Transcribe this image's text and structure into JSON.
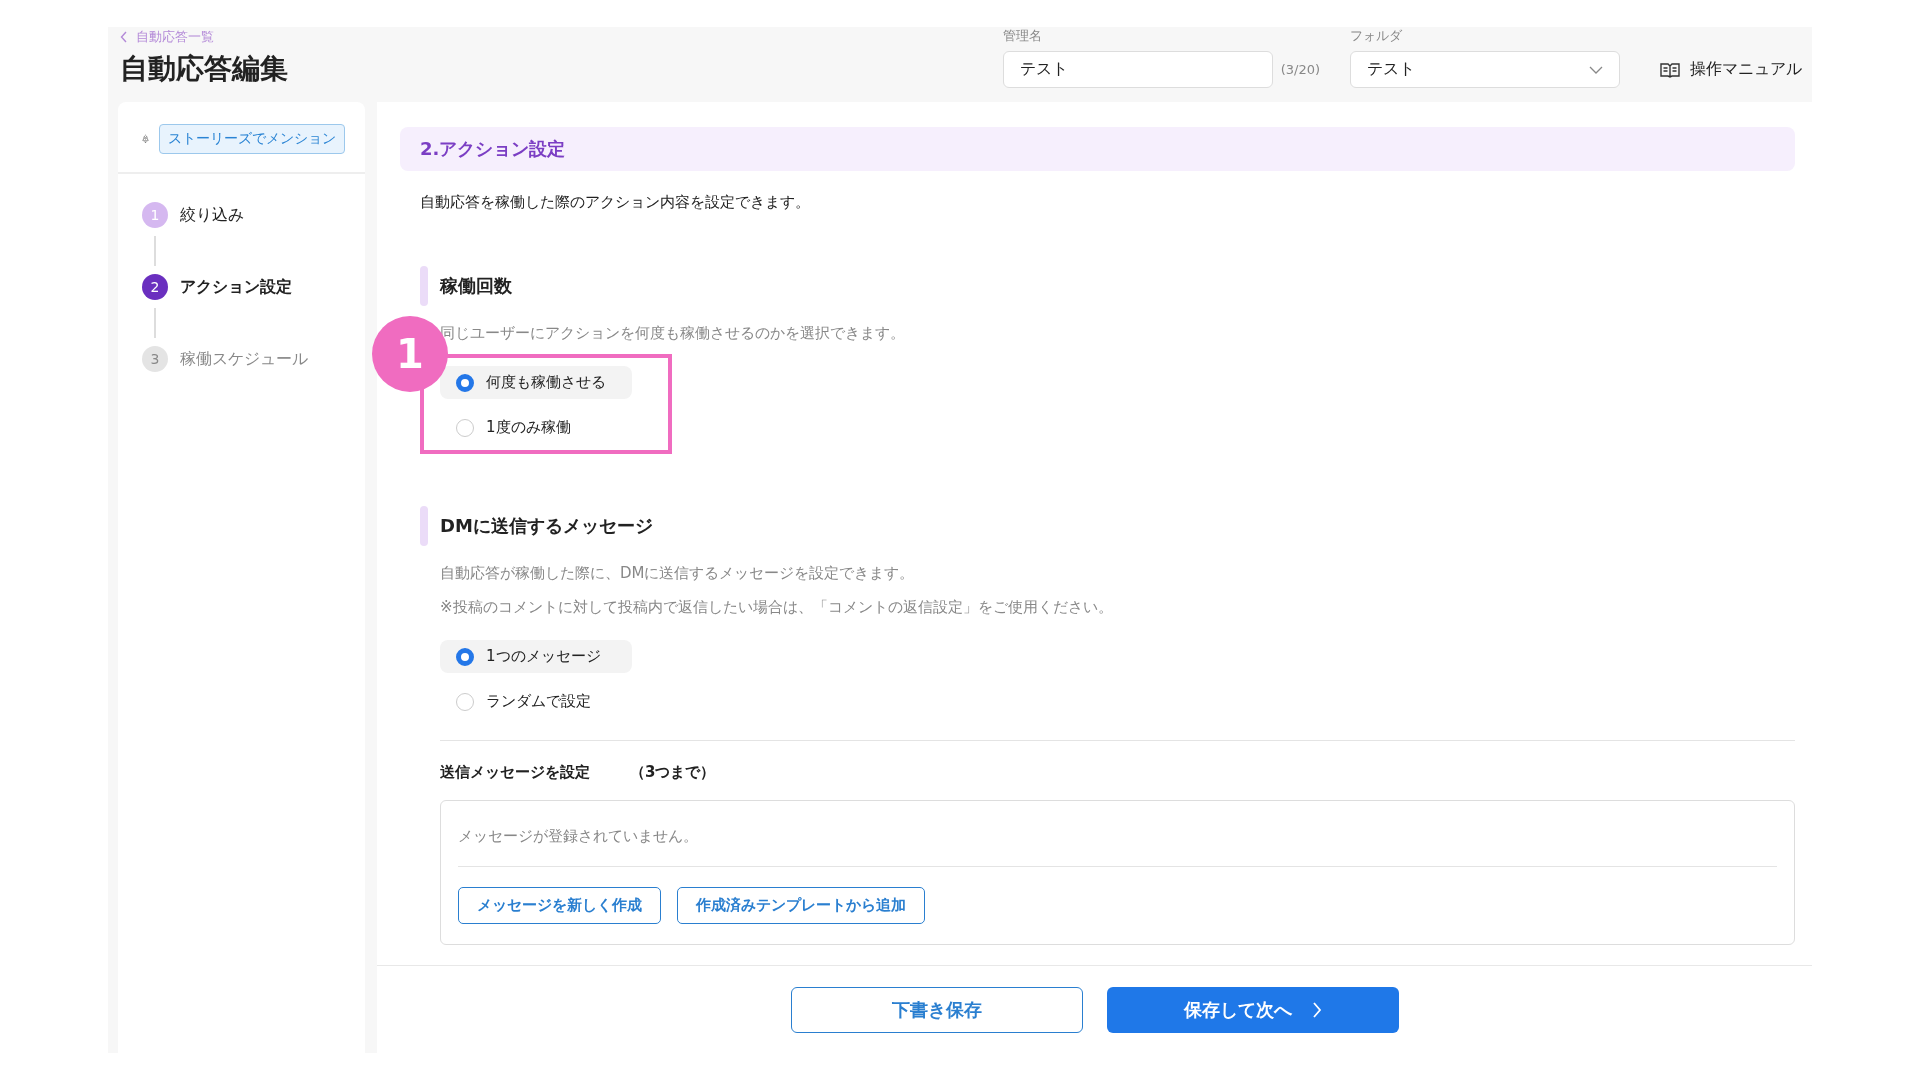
{
  "header": {
    "back_link": "自動応答一覧",
    "title": "自動応答編集",
    "name_field": {
      "label": "管理名",
      "value": "テスト",
      "counter": "(3/20)"
    },
    "folder_field": {
      "label": "フォルダ",
      "value": "テスト"
    },
    "manual_link": "操作マニュアル"
  },
  "sidebar": {
    "trigger_tag": "ストーリーズでメンション",
    "steps": [
      {
        "number": "1",
        "label": "絞り込み",
        "kind": "done"
      },
      {
        "number": "2",
        "label": "アクション設定",
        "kind": "current"
      },
      {
        "number": "3",
        "label": "稼働スケジュール",
        "kind": "todo"
      }
    ]
  },
  "main": {
    "section_title": "2.アクション設定",
    "description": "自動応答を稼働した際のアクション内容を設定できます。",
    "groups": [
      {
        "heading": "稼働回数",
        "hints": [
          "同じユーザーにアクションを何度も稼働させるのかを選択できます。"
        ],
        "annotation": "1",
        "options": [
          {
            "label": "何度も稼働させる",
            "selected": true
          },
          {
            "label": "1度のみ稼働",
            "selected": false
          }
        ]
      },
      {
        "heading": "DMに送信するメッセージ",
        "hints": [
          "自動応答が稼働した際に、DMに送信するメッセージを設定できます。",
          "※投稿のコメントに対して投稿内で返信したい場合は、「コメントの返信設定」をご使用ください。"
        ],
        "options": [
          {
            "label": "1つのメッセージ",
            "selected": true
          },
          {
            "label": "ランダムで設定",
            "selected": false
          }
        ]
      }
    ],
    "messages": {
      "label": "送信メッセージを設定",
      "limit": "（3つまで）",
      "empty_text": "メッセージが登録されていません。",
      "buttons": [
        "メッセージを新しく作成",
        "作成済みテンプレートから追加"
      ]
    }
  },
  "footer": {
    "draft_button": "下書き保存",
    "next_button": "保存して次へ"
  }
}
